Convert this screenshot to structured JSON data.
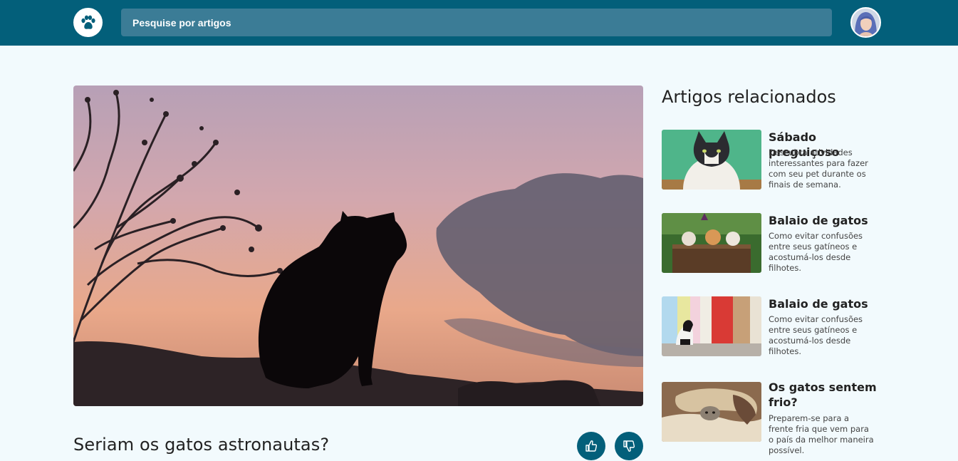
{
  "header": {
    "logo_icon": "paw-icon",
    "search_placeholder": "Pesquise por artigos",
    "avatar_icon": "user-avatar"
  },
  "colors": {
    "header_bg": "#035f7a",
    "search_bg": "#3b7c96",
    "page_bg": "#f2fafd",
    "accent": "#035f7a"
  },
  "article": {
    "image": "black cat silhouette at sunset",
    "title": "Seriam os gatos astronautas?",
    "like_icon": "thumbs-up-icon",
    "dislike_icon": "thumbs-down-icon"
  },
  "sidebar": {
    "title": "Artigos relacionados",
    "items": [
      {
        "title": "Sábado preguiçoso",
        "description": "Descubra atividades interessantes para fazer com seu pet durante os finais de semana."
      },
      {
        "title": "Balaio de gatos",
        "description": "Como evitar confusões entre seus gatíneos e acostumá-los desde filhotes."
      },
      {
        "title": "Balaio de gatos",
        "description": "Como evitar confusões entre seus gatíneos e acostumá-los desde filhotes."
      },
      {
        "title": "Os gatos sentem frio?",
        "description": "Preparem-se para a frente fria que vem para o país da melhor maneira possível."
      }
    ]
  }
}
